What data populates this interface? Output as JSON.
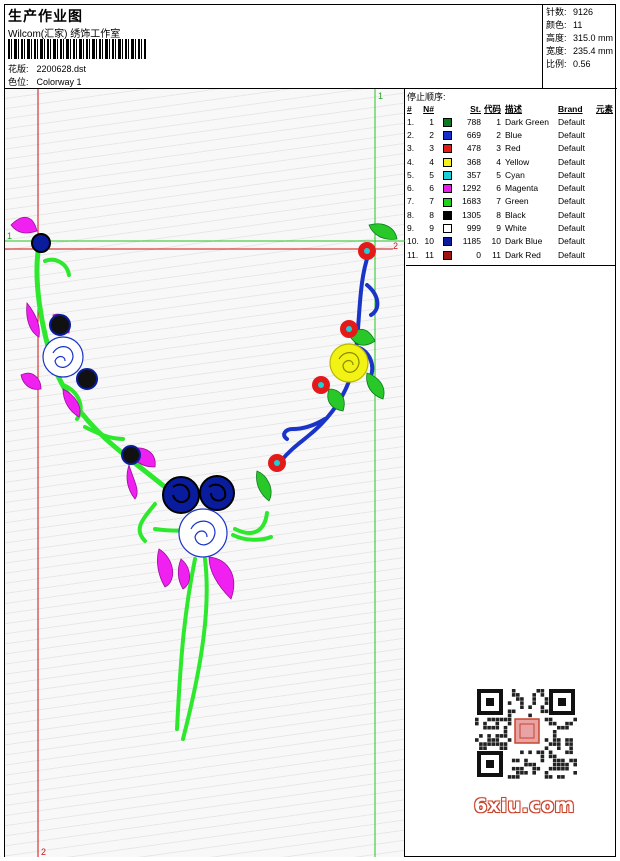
{
  "header": {
    "title": "生产作业图",
    "company": "Wilcom(汇家) 绣饰工作室",
    "design": {
      "label": "花版:",
      "value": "2200628.dst"
    },
    "colorway": {
      "label": "色位:",
      "value": "Colorway 1"
    }
  },
  "stats": [
    {
      "label": "针数:",
      "value": "9126"
    },
    {
      "label": "颜色:",
      "value": "11"
    },
    {
      "label": "高度:",
      "value": "315.0 mm"
    },
    {
      "label": "宽度:",
      "value": "235.4 mm"
    },
    {
      "label": "比例:",
      "value": "0.56"
    }
  ],
  "canvas": {
    "marker_1_top": "1",
    "marker_1_left": "1",
    "marker_2_right": "2",
    "marker_2_bottom": "2"
  },
  "stop_sequence": {
    "title": "停止顺序:",
    "headers": [
      "#",
      "N#",
      "St.",
      "代码",
      "描述",
      "Brand",
      "元素"
    ],
    "rows": [
      {
        "idx": "1.",
        "n": "1",
        "color": "#0b7a1e",
        "st": "788",
        "code": "1",
        "desc": "Dark Green",
        "brand": "Default"
      },
      {
        "idx": "2.",
        "n": "2",
        "color": "#1530c8",
        "st": "669",
        "code": "2",
        "desc": "Blue",
        "brand": "Default"
      },
      {
        "idx": "3.",
        "n": "3",
        "color": "#e41a1a",
        "st": "478",
        "code": "3",
        "desc": "Red",
        "brand": "Default"
      },
      {
        "idx": "4.",
        "n": "4",
        "color": "#f2f214",
        "st": "368",
        "code": "4",
        "desc": "Yellow",
        "brand": "Default"
      },
      {
        "idx": "5.",
        "n": "5",
        "color": "#18d2d8",
        "st": "357",
        "code": "5",
        "desc": "Cyan",
        "brand": "Default"
      },
      {
        "idx": "6.",
        "n": "6",
        "color": "#e61ee6",
        "st": "1292",
        "code": "6",
        "desc": "Magenta",
        "brand": "Default"
      },
      {
        "idx": "7.",
        "n": "7",
        "color": "#1ed21e",
        "st": "1683",
        "code": "7",
        "desc": "Green",
        "brand": "Default"
      },
      {
        "idx": "8.",
        "n": "8",
        "color": "#000000",
        "st": "1305",
        "code": "8",
        "desc": "Black",
        "brand": "Default"
      },
      {
        "idx": "9.",
        "n": "9",
        "color": "#ffffff",
        "st": "999",
        "code": "9",
        "desc": "White",
        "brand": "Default"
      },
      {
        "idx": "10.",
        "n": "10",
        "color": "#0a1c9e",
        "st": "1185",
        "code": "10",
        "desc": "Dark Blue",
        "brand": "Default"
      },
      {
        "idx": "11.",
        "n": "11",
        "color": "#9e1414",
        "st": "0",
        "code": "11",
        "desc": "Dark Red",
        "brand": "Default"
      }
    ]
  },
  "watermark": {
    "site": "6xiu.com",
    "icon": "qr-code-icon",
    "accent": "#c8452f"
  }
}
